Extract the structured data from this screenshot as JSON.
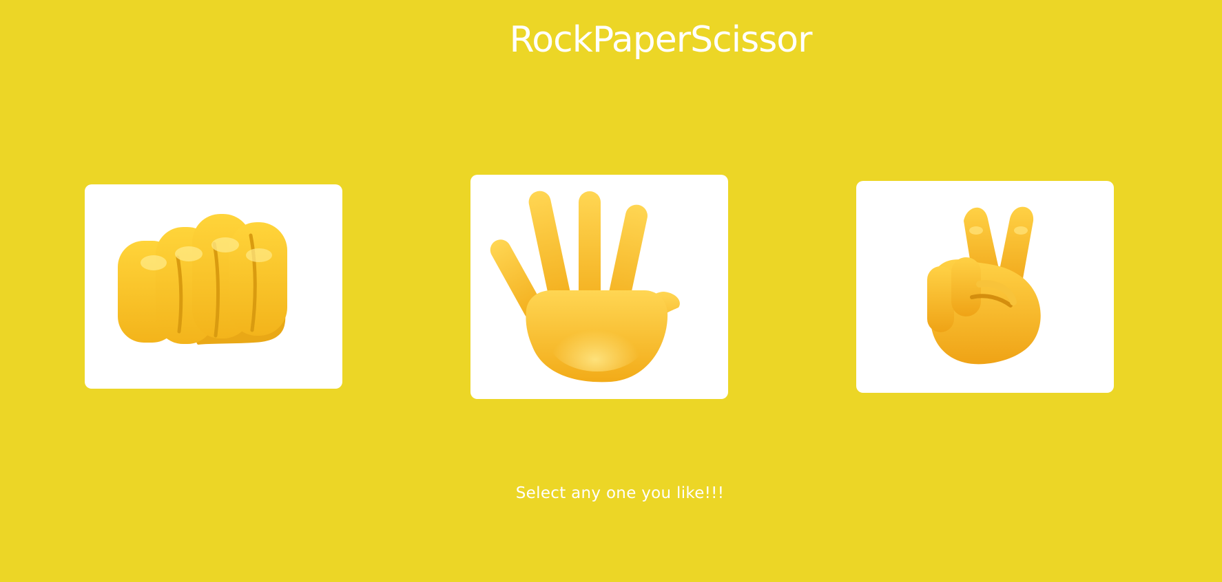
{
  "header": {
    "title": "RockPaperScissor"
  },
  "choices": [
    {
      "name": "rock",
      "icon": "fist-icon"
    },
    {
      "name": "paper",
      "icon": "raised-hand-icon"
    },
    {
      "name": "scissor",
      "icon": "victory-hand-icon"
    }
  ],
  "footer": {
    "prompt": "Select any one you like!!!"
  },
  "colors": {
    "background": "#ecd626",
    "card": "#ffffff",
    "text": "#ffffff",
    "skin_light": "#ffd84a",
    "skin_dark": "#f2a917"
  }
}
